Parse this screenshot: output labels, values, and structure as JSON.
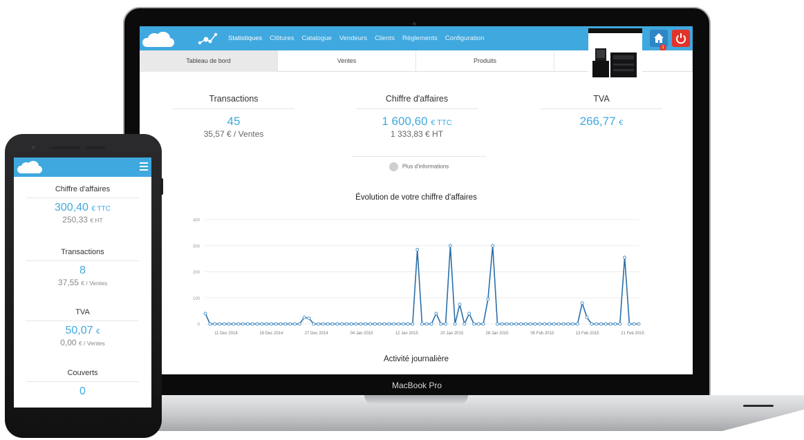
{
  "laptop": {
    "device_label": "MacBook Pro",
    "nav": {
      "items": [
        "Statistiques",
        "Clôtures",
        "Catalogue",
        "Vendeurs",
        "Clients",
        "Règlements",
        "Configuration"
      ],
      "active": "Statistiques",
      "home_badge": "1"
    },
    "tabs": [
      "Tableau de bord",
      "Ventes",
      "Produits",
      ""
    ],
    "active_tab": "Tableau de bord",
    "stats": {
      "transactions": {
        "title": "Transactions",
        "value": "45",
        "sub_value": "35,57",
        "sub_unit": "€ / Ventes"
      },
      "revenue": {
        "title": "Chiffre d'affaires",
        "value": "1 600,60",
        "unit": "€ TTC",
        "sub_value": "1 333,83",
        "sub_unit": "€ HT"
      },
      "tva": {
        "title": "TVA",
        "value": "266,77",
        "unit": "€"
      }
    },
    "more_info": "Plus d'informations",
    "chart_title": "Évolution de votre chiffre d'affaires",
    "activity_title": "Activité journalière"
  },
  "phone": {
    "stats": {
      "revenue": {
        "title": "Chiffre d'affaires",
        "value": "300,40",
        "unit": "€ TTC",
        "sub_value": "250,33",
        "sub_unit": "€ HT"
      },
      "transactions": {
        "title": "Transactions",
        "value": "8",
        "sub_value": "37,55",
        "sub_unit": "€ / Ventes"
      },
      "tva": {
        "title": "TVA",
        "value": "50,07",
        "unit": "€",
        "sub_value": "0,00",
        "sub_unit": "€ / Ventes"
      },
      "covers": {
        "title": "Couverts",
        "value": "0"
      }
    }
  },
  "chart_data": {
    "type": "line",
    "title": "Évolution de votre chiffre d'affaires",
    "ylim": [
      0,
      400
    ],
    "yticks": [
      0,
      100,
      200,
      300,
      400
    ],
    "x_tick_labels": [
      "11 Dec 2014",
      "19 Dec 2014",
      "27 Dec 2014",
      "04 Jan 2015",
      "12 Jan 2015",
      "20 Jan 2015",
      "28 Jan 2015",
      "05 Feb 2015",
      "13 Feb 2015",
      "21 Feb 2015"
    ],
    "grid": true,
    "series": [
      {
        "color": "#2a6ea8",
        "values": [
          40,
          0,
          0,
          0,
          0,
          0,
          0,
          0,
          0,
          0,
          0,
          0,
          0,
          0,
          0,
          0,
          0,
          0,
          0,
          0,
          0,
          25,
          22,
          0,
          0,
          0,
          0,
          0,
          0,
          0,
          0,
          0,
          0,
          0,
          0,
          0,
          0,
          0,
          0,
          0,
          0,
          0,
          0,
          0,
          0,
          285,
          0,
          0,
          0,
          40,
          0,
          0,
          300,
          0,
          75,
          0,
          40,
          0,
          0,
          0,
          95,
          300,
          0,
          0,
          0,
          0,
          0,
          0,
          0,
          0,
          0,
          0,
          0,
          0,
          0,
          0,
          0,
          0,
          0,
          0,
          80,
          25,
          0,
          0,
          0,
          0,
          0,
          0,
          0,
          255,
          0,
          0,
          0
        ]
      }
    ]
  }
}
